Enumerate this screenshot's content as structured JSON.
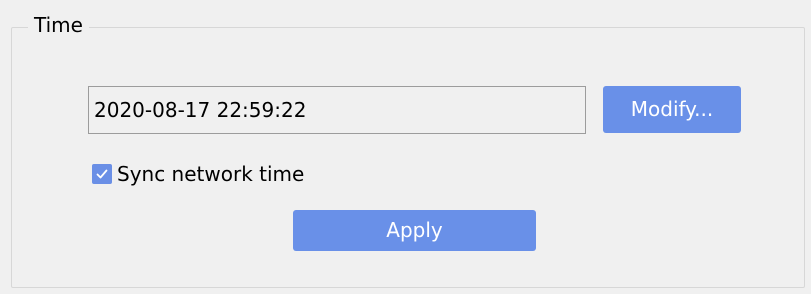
{
  "time_group": {
    "title": "Time",
    "datetime_value": "2020-08-17 22:59:22",
    "modify_label": "Modify...",
    "sync_label": "Sync network time",
    "sync_checked": true,
    "apply_label": "Apply"
  },
  "colors": {
    "button_background": "#6990e8",
    "button_text": "#ffffff",
    "checkbox_fill": "#6a8fe6",
    "panel_background": "#f0f0f0",
    "field_border": "#9c9c9c",
    "group_border": "#d7d7d7"
  },
  "icons": {
    "checkbox_mark": "check-icon"
  }
}
